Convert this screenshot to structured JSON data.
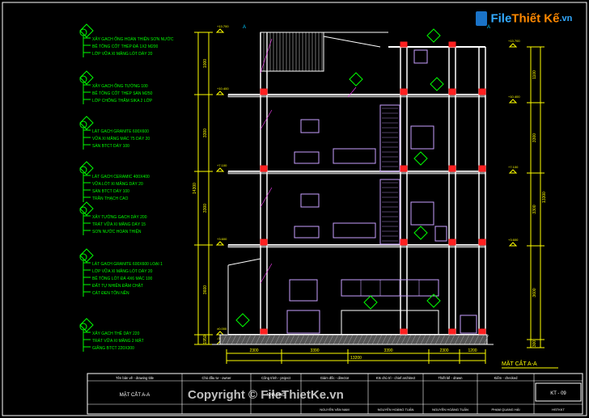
{
  "drawing": {
    "section_title": "MẶT CẮT A-A",
    "section_marker_left": "A",
    "section_marker_right": "A",
    "notes": [
      [
        "XÂY GẠCH ỐNG HOÀN THIỆN SƠN NƯỚC",
        "BÊ TÔNG CỐT THÉP ĐÁ 1X2 M200",
        "LỚP VỮA XI MĂNG LÓT DÀY 20"
      ],
      [
        "XÂY GẠCH ỐNG TƯỜNG 100",
        "BÊ TÔNG CỐT THÉP SÀN M250",
        "LỚP CHỐNG THẤM SIKA 2 LỚP"
      ],
      [
        "LÁT GẠCH GRANITE 600X600",
        "VỮA XI MĂNG MÁC 75 DÀY 20",
        "SÀN BTCT DÀY 100"
      ],
      [
        "LÁT GẠCH CERAMIC 400X400",
        "VỮA LÓT XI MĂNG DÀY 20",
        "SÀN BTCT DÀY 100",
        "TRẦN THẠCH CAO"
      ],
      [
        "XÂY TƯỜNG GẠCH DÀY 200",
        "TRÁT VỮA XI MĂNG DÀY 15",
        "SƠN NƯỚC HOÀN THIỆN"
      ],
      [
        "LÁT GẠCH GRANITE 600X600 LOẠI 1",
        "LỚP VỮA XI MĂNG LÓT DÀY 20",
        "BÊ TÔNG LÓT ĐÁ 4X6 MÁC 100",
        "ĐẤT TỰ NHIÊN ĐẦM CHẶT",
        "CÁT ĐEN TÔN NỀN"
      ],
      [
        "XÂY GẠCH THẺ DÀY 220",
        "TRÁT VỮA XI MĂNG 2 MẶT",
        "GIẰNG BTCT 220X300"
      ]
    ],
    "dimensions_bottom": [
      "2300",
      "3390",
      "3390",
      "2300",
      "1200"
    ],
    "dimension_total": "13200",
    "left_heights": [
      "1000",
      "3300",
      "3300",
      "3600",
      "1950",
      "600"
    ],
    "left_total": "14300",
    "right_heights": [
      "1100",
      "3300",
      "3300",
      "3600",
      "300"
    ],
    "right_total": "13300",
    "level_markers": [
      "+13.700",
      "+10.400",
      "+7.100",
      "+3.600",
      "±0.000",
      "-0.450"
    ]
  },
  "title_block": {
    "headers": [
      "Tên bản vẽ - drawing title",
      "Chủ đầu tư - owner",
      "Công trình - project",
      "Giám đốc - director",
      "Kts chủ trì - chief architect",
      "Thiết kế - drawn",
      "Kiểm - checked"
    ],
    "drawing_name": "MẶT CẮT A-A",
    "owner_value": "",
    "project_value": "NHÀ PHỐ",
    "signers": [
      "NGUYỄN VĂN NAM",
      "NGUYỄN HOÀNG TUẤN",
      "NGUYỄN HOÀNG TUẤN",
      "PHẠM QUANG HẢI"
    ],
    "sheet_no": "KT - 09",
    "sheet_note": "HSTKKT"
  },
  "watermark": {
    "logo_text_1": "File",
    "logo_text_2": "Thiết Kế",
    "logo_suffix": ".vn",
    "bottom": "Copyright © FileThietKe.vn"
  },
  "colors": {
    "background": "#000000",
    "structure": "#ffffff",
    "notes": "#00ff00",
    "dimension": "#ffff00",
    "furniture": "#c8a0ff",
    "beam": "#ff2020",
    "leader": "#ff40ff",
    "cyan": "#00c8ff"
  }
}
